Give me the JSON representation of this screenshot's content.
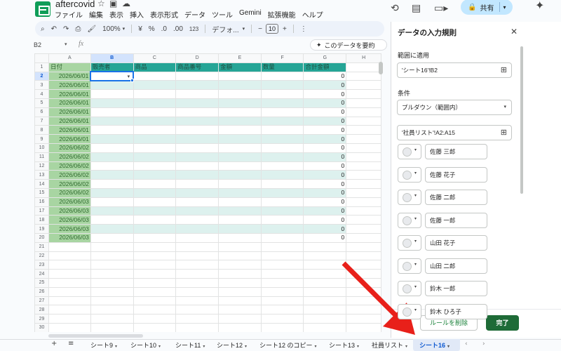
{
  "doc": {
    "title": "aftercovid",
    "menu": [
      "ファイル",
      "編集",
      "表示",
      "挿入",
      "表示形式",
      "データ",
      "ツール",
      "Gemini",
      "拡張機能",
      "ヘルプ"
    ],
    "share_label": "共有"
  },
  "toolbar": {
    "zoom": "100%",
    "currency": "¥",
    "percent": "%",
    "dec_decrease": ".0",
    "dec_increase": ".00",
    "number_format": "123",
    "font": "デフォ...",
    "font_size": "10",
    "minus": "−",
    "plus": "+"
  },
  "formula_bar": {
    "cell_ref": "B2",
    "fx": "fx",
    "summarize_label": "このデータを要約"
  },
  "sheet": {
    "columns": [
      "A",
      "B",
      "C",
      "D",
      "E",
      "F",
      "G",
      "H"
    ],
    "header_row": [
      "日付",
      "販売者",
      "商品",
      "商品番号",
      "金額",
      "数量",
      "合計金額",
      ""
    ],
    "dates": [
      "2026/06/01",
      "2026/06/01",
      "2026/06/01",
      "2026/06/01",
      "2026/06/01",
      "2026/06/01",
      "2026/06/01",
      "2026/06/01",
      "2026/06/02",
      "2026/06/02",
      "2026/06/02",
      "2026/06/02",
      "2026/06/02",
      "2026/06/02",
      "2026/06/03",
      "2026/06/03",
      "2026/06/03",
      "2026/06/03",
      "2026/06/03"
    ],
    "totals": [
      "0",
      "0",
      "0",
      "0",
      "0",
      "0",
      "0",
      "0",
      "0",
      "0",
      "0",
      "0",
      "0",
      "0",
      "0",
      "0",
      "0",
      "0",
      "0"
    ],
    "row_numbers": [
      "1",
      "2",
      "3",
      "4",
      "5",
      "6",
      "7",
      "8",
      "9",
      "10",
      "11",
      "12",
      "13",
      "14",
      "15",
      "16",
      "17",
      "18",
      "19",
      "20",
      "21",
      "22",
      "23",
      "24",
      "25",
      "26",
      "27",
      "28",
      "29",
      "30"
    ]
  },
  "panel": {
    "title": "データの入力規則",
    "range_label": "範囲に適用",
    "range_value": "'シート16'!B2",
    "criteria_label": "条件",
    "criteria_value": "プルダウン（範囲内）",
    "source_range": "'社員リスト'!A2:A15",
    "options": [
      "佐藤 三郎",
      "佐藤 花子",
      "佐藤 二郎",
      "佐藤 一郎",
      "山田 花子",
      "山田 二郎",
      "鈴木 一郎",
      "鈴木 ひろ子"
    ],
    "remove_label": "ルールを削除",
    "done_label": "完了"
  },
  "tabs": {
    "items": [
      "シート9",
      "シート10",
      "シート11",
      "シート12",
      "シート12 のコピー",
      "シート13",
      "社員リスト",
      "シート16"
    ],
    "active": "シート16"
  },
  "colors": {
    "header_teal": "#25a596",
    "date_green": "#a8d5a2",
    "band_light": "#ddf1ee",
    "done_button": "#1e6b37",
    "share_button": "#c2e7ff",
    "arrow_red": "#e8201a"
  }
}
